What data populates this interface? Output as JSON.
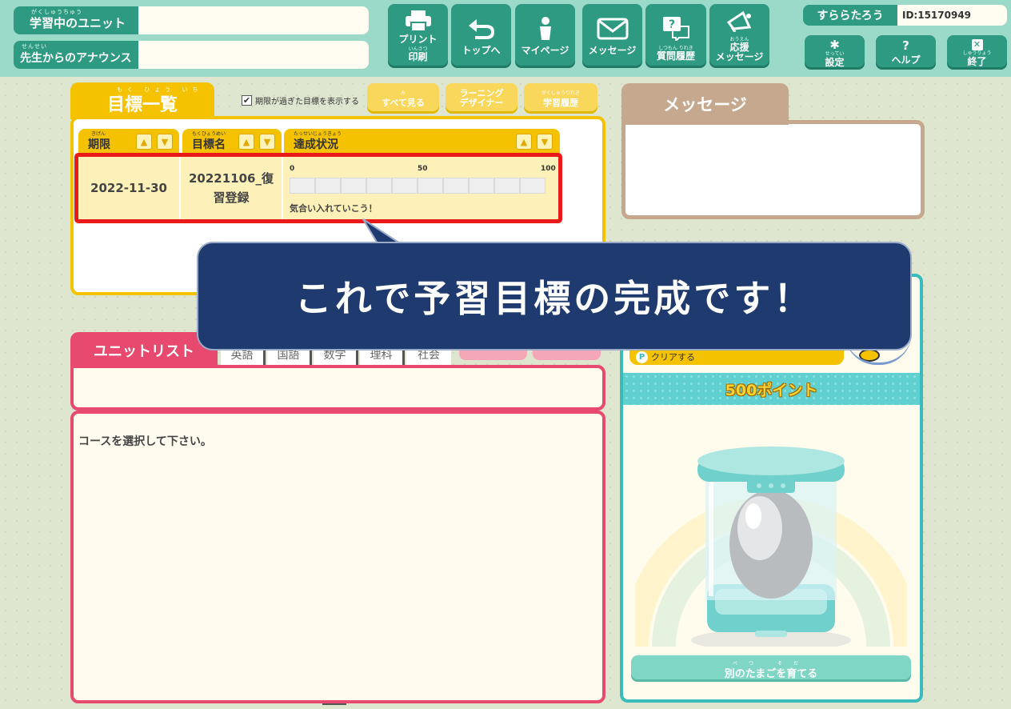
{
  "header": {
    "studying_unit_label": "学習中のユニット",
    "studying_unit_ruby": "がくしゅうちゅう",
    "studying_unit_value": "",
    "announce_label": "先生からのアナウンス",
    "announce_ruby": "せんせい",
    "announce_value": "",
    "nav": [
      {
        "label": "プリント",
        "sub": "印刷",
        "ruby": "いんさつ",
        "icon": "printer-icon"
      },
      {
        "label": "トップへ",
        "icon": "back-arrow-icon"
      },
      {
        "label": "マイページ",
        "icon": "person-icon"
      },
      {
        "label": "メッセージ",
        "icon": "envelope-icon"
      },
      {
        "label": "質問履歴",
        "ruby": "しつもん りれき",
        "icon": "question-bubble-icon"
      },
      {
        "label": "応援",
        "sub": "メッセージ",
        "ruby": "おうえん",
        "icon": "megaphone-icon"
      }
    ],
    "user_name": "すららたろう",
    "user_id": "ID:15170949",
    "settings_label": "設定",
    "settings_ruby": "せってい",
    "help_label": "ヘルプ",
    "exit_label": "終了",
    "exit_ruby": "しゅうりょう"
  },
  "goals": {
    "title": "目標一覧",
    "title_ruby": "もく ひょう いち らん",
    "show_expired_label": "期限が過ぎた目標を表示する",
    "show_expired_checked": "✔",
    "buttons": {
      "see_all": "すべて見る",
      "see_all_ruby": "み",
      "learning_designer": "ラーニング\nデザイナー",
      "history": "学習履歴",
      "history_ruby": "がくしゅうりれき"
    },
    "columns": [
      {
        "label": "期限",
        "ruby": "きげん"
      },
      {
        "label": "目標名",
        "ruby": "もくひょうめい"
      },
      {
        "label": "達成状況",
        "ruby": "たっせいじょうきょう"
      }
    ],
    "rows": [
      {
        "deadline": "2022-11-30",
        "name": "20221106_復習登録",
        "scale_min": "0",
        "scale_mid": "50",
        "scale_max": "100",
        "progress": 0,
        "comment": "気合い入れていこう！"
      }
    ]
  },
  "message_panel": {
    "title": "メッセージ"
  },
  "pet_panel": {
    "clear_label": "クリアする",
    "points": "500ポイント",
    "raise_button": "別のたまごを育てる",
    "raise_ruby": "べつ そだ"
  },
  "unit_list": {
    "title": "ユニットリスト",
    "subjects": [
      "英語",
      "国語",
      "数学",
      "理科",
      "社会"
    ],
    "empty_message": "コースを選択して下さい。"
  },
  "callout": {
    "text": "これで予習目標の完成です！"
  },
  "colors": {
    "header": "#9bd9c9",
    "accent_green": "#2e9a82",
    "goal_yellow": "#f5c200",
    "unit_pink": "#e8496f",
    "message_tan": "#c6a88f",
    "pet_teal": "#3bbcbc",
    "callout_navy": "#1f3a6e",
    "highlight_red": "#e81a1a"
  }
}
